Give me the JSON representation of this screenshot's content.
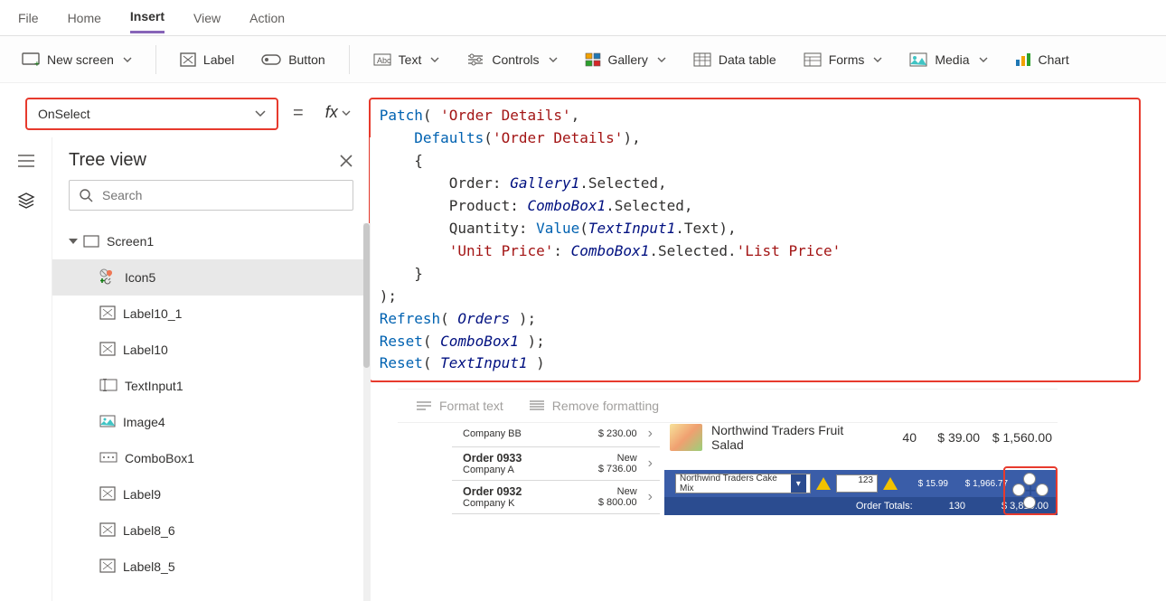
{
  "menubar": {
    "file": "File",
    "home": "Home",
    "insert": "Insert",
    "view": "View",
    "action": "Action"
  },
  "ribbon": {
    "new_screen": "New screen",
    "label": "Label",
    "button": "Button",
    "text": "Text",
    "controls": "Controls",
    "gallery": "Gallery",
    "data_table": "Data table",
    "forms": "Forms",
    "media": "Media",
    "chart": "Chart"
  },
  "property": {
    "selected": "OnSelect",
    "fx": "fx"
  },
  "formula_tokens": [
    [
      {
        "c": "blue",
        "t": "Patch"
      },
      {
        "c": "plain",
        "t": "( "
      },
      {
        "c": "str",
        "t": "'Order Details'"
      },
      {
        "c": "plain",
        "t": ","
      }
    ],
    [
      {
        "c": "plain",
        "t": "    "
      },
      {
        "c": "blue",
        "t": "Defaults"
      },
      {
        "c": "plain",
        "t": "("
      },
      {
        "c": "str",
        "t": "'Order Details'"
      },
      {
        "c": "plain",
        "t": "),"
      }
    ],
    [
      {
        "c": "plain",
        "t": "    {"
      }
    ],
    [
      {
        "c": "plain",
        "t": "        Order: "
      },
      {
        "c": "navy",
        "t": "Gallery1"
      },
      {
        "c": "plain",
        "t": ".Selected,"
      }
    ],
    [
      {
        "c": "plain",
        "t": "        Product: "
      },
      {
        "c": "navy",
        "t": "ComboBox1"
      },
      {
        "c": "plain",
        "t": ".Selected,"
      }
    ],
    [
      {
        "c": "plain",
        "t": "        Quantity: "
      },
      {
        "c": "blue",
        "t": "Value"
      },
      {
        "c": "plain",
        "t": "("
      },
      {
        "c": "navy",
        "t": "TextInput1"
      },
      {
        "c": "plain",
        "t": ".Text),"
      }
    ],
    [
      {
        "c": "plain",
        "t": "        "
      },
      {
        "c": "str",
        "t": "'Unit Price'"
      },
      {
        "c": "plain",
        "t": ": "
      },
      {
        "c": "navy",
        "t": "ComboBox1"
      },
      {
        "c": "plain",
        "t": ".Selected."
      },
      {
        "c": "str",
        "t": "'List Price'"
      }
    ],
    [
      {
        "c": "plain",
        "t": "    }"
      }
    ],
    [
      {
        "c": "plain",
        "t": ");"
      }
    ],
    [
      {
        "c": "blue",
        "t": "Refresh"
      },
      {
        "c": "plain",
        "t": "( "
      },
      {
        "c": "navy",
        "t": "Orders"
      },
      {
        "c": "plain",
        "t": " );"
      }
    ],
    [
      {
        "c": "blue",
        "t": "Reset"
      },
      {
        "c": "plain",
        "t": "( "
      },
      {
        "c": "navy",
        "t": "ComboBox1"
      },
      {
        "c": "plain",
        "t": " );"
      }
    ],
    [
      {
        "c": "blue",
        "t": "Reset"
      },
      {
        "c": "plain",
        "t": "( "
      },
      {
        "c": "navy",
        "t": "TextInput1"
      },
      {
        "c": "plain",
        "t": " )"
      }
    ]
  ],
  "fmtbar": {
    "format": "Format text",
    "remove": "Remove formatting"
  },
  "tree": {
    "title": "Tree view",
    "search_placeholder": "Search",
    "root": "Screen1",
    "items": [
      {
        "name": "Icon5",
        "type": "icon-add",
        "selected": true
      },
      {
        "name": "Label10_1",
        "type": "label"
      },
      {
        "name": "Label10",
        "type": "label"
      },
      {
        "name": "TextInput1",
        "type": "textinput"
      },
      {
        "name": "Image4",
        "type": "image"
      },
      {
        "name": "ComboBox1",
        "type": "combobox"
      },
      {
        "name": "Label9",
        "type": "label"
      },
      {
        "name": "Label8_6",
        "type": "label"
      },
      {
        "name": "Label8_5",
        "type": "label"
      }
    ]
  },
  "canvas": {
    "orders": [
      {
        "l1": "Company BB",
        "r1": "$ 230.00",
        "l2": "",
        "r2": ""
      },
      {
        "l1": "Order 0933",
        "r1": "New",
        "l2": "Company A",
        "r2": "$ 736.00"
      },
      {
        "l1": "Order 0932",
        "r1": "New",
        "l2": "Company K",
        "r2": "$ 800.00"
      }
    ],
    "detail_row": {
      "name": "Northwind Traders Fruit Salad",
      "qty": "40",
      "price": "$ 39.00",
      "total": "$ 1,560.00"
    },
    "edit_row": {
      "combo": "Northwind Traders Cake Mix",
      "qty": "123",
      "price": "$ 15.99",
      "total": "$ 1,966.77"
    },
    "totals": {
      "label": "Order Totals:",
      "qty": "130",
      "amount": "$ 3,810.00"
    }
  }
}
